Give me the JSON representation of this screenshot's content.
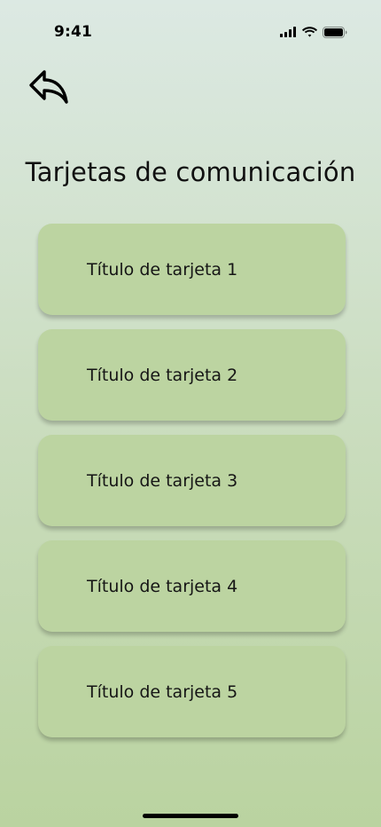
{
  "status_bar": {
    "time": "9:41",
    "icons": [
      "cellular-signal-icon",
      "wifi-icon",
      "battery-icon"
    ]
  },
  "header": {
    "back_icon": "back-arrow-icon",
    "title": "Tarjetas de comunicación"
  },
  "cards": [
    {
      "label": "Título de tarjeta 1"
    },
    {
      "label": "Título de tarjeta 2"
    },
    {
      "label": "Título de tarjeta 3"
    },
    {
      "label": "Título de tarjeta 4"
    },
    {
      "label": "Título de tarjeta 5"
    }
  ],
  "colors": {
    "background_top": "#dce9e3",
    "background_bottom": "#bad3a0",
    "card": "#bcd4a1",
    "text": "#111111"
  }
}
